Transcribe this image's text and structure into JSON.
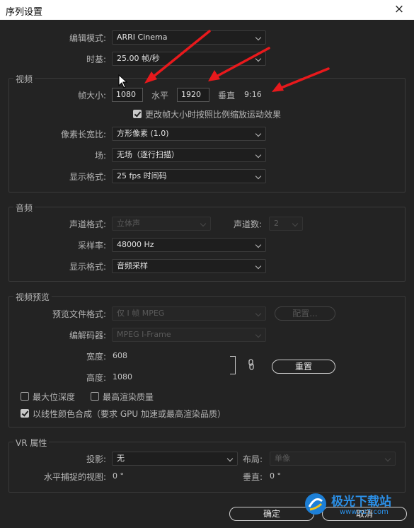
{
  "window": {
    "title": "序列设置",
    "close": "×"
  },
  "top": {
    "edit_mode_label": "编辑模式:",
    "edit_mode_value": "ARRI Cinema",
    "timebase_label": "时基:",
    "timebase_value": "25.00  帧/秒"
  },
  "video": {
    "title": "视频",
    "frame_size_label": "帧大小:",
    "frame_size_value": "1080",
    "horizontal_label": "水平",
    "horizontal_value": "1920",
    "vertical_label": "垂直",
    "aspect_value": "9:16",
    "scale_checkbox_label": "更改帧大小时按照比例缩放运动效果",
    "scale_checked": true,
    "pixel_aspect_label": "像素长宽比:",
    "pixel_aspect_value": "方形像素 (1.0)",
    "fields_label": "场:",
    "fields_value": "无场（逐行扫描）",
    "display_format_label": "显示格式:",
    "display_format_value": "25 fps 时间码"
  },
  "audio": {
    "title": "音频",
    "channel_format_label": "声道格式:",
    "channel_format_value": "立体声",
    "channels_label": "声道数:",
    "channels_value": "2",
    "sample_rate_label": "采样率:",
    "sample_rate_value": "48000 Hz",
    "display_format_label": "显示格式:",
    "display_format_value": "音频采样"
  },
  "preview": {
    "title": "视频预览",
    "file_format_label": "预览文件格式:",
    "file_format_value": "仅 I 帧 MPEG",
    "config_button": "配置...",
    "codec_label": "编解码器:",
    "codec_value": "MPEG I-Frame",
    "width_label": "宽度:",
    "width_value": "608",
    "height_label": "高度:",
    "height_value": "1080",
    "reset_button": "重置",
    "max_depth_label": "最大位深度",
    "max_depth_checked": false,
    "max_quality_label": "最高渲染质量",
    "max_quality_checked": false,
    "linear_color_label": "以线性颜色合成（要求 GPU 加速或最高渲染品质）",
    "linear_color_checked": true
  },
  "vr": {
    "title": "VR 属性",
    "projection_label": "投影:",
    "projection_value": "无",
    "layout_label": "布局:",
    "layout_value": "单像",
    "captured_view_label": "水平捕捉的视图:",
    "captured_view_value": "0 °",
    "vertical_label": "垂直:",
    "vertical_value": "0 °"
  },
  "footer": {
    "ok": "确定",
    "cancel": "取消"
  },
  "watermark": {
    "text": "极光下载站",
    "url": "www.xz7.com"
  },
  "colors": {
    "accent_blue": "#3d9bf0",
    "annotation_red": "#e8191c"
  }
}
